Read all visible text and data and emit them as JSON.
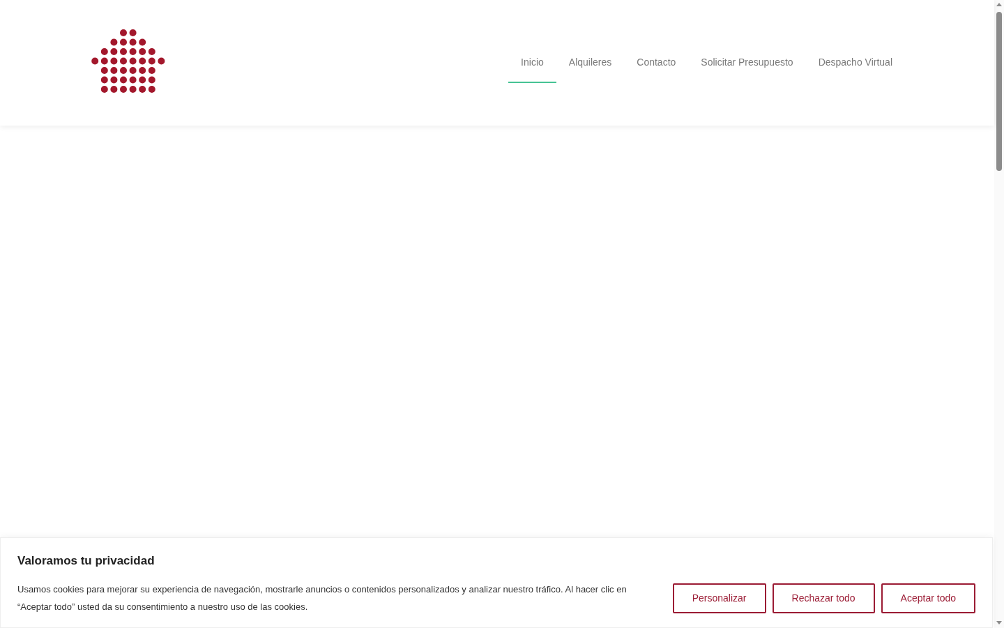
{
  "header": {
    "nav": [
      {
        "label": "Inicio",
        "selected": true
      },
      {
        "label": "Alquileres",
        "selected": false
      },
      {
        "label": "Contacto",
        "selected": false
      },
      {
        "label": "Solicitar Presupuesto",
        "selected": false
      },
      {
        "label": "Despacho Virtual",
        "selected": false
      }
    ]
  },
  "cookie_banner": {
    "title": "Valoramos tu privacidad",
    "text": "Usamos cookies para mejorar su experiencia de navegación, mostrarle anuncios o contenidos personalizados y analizar nuestro tráfico. Al hacer clic en “Aceptar todo” usted da su consentimiento a nuestro uso de las cookies.",
    "buttons": [
      "Personalizar",
      "Rechazar todo",
      "Aceptar todo"
    ]
  }
}
